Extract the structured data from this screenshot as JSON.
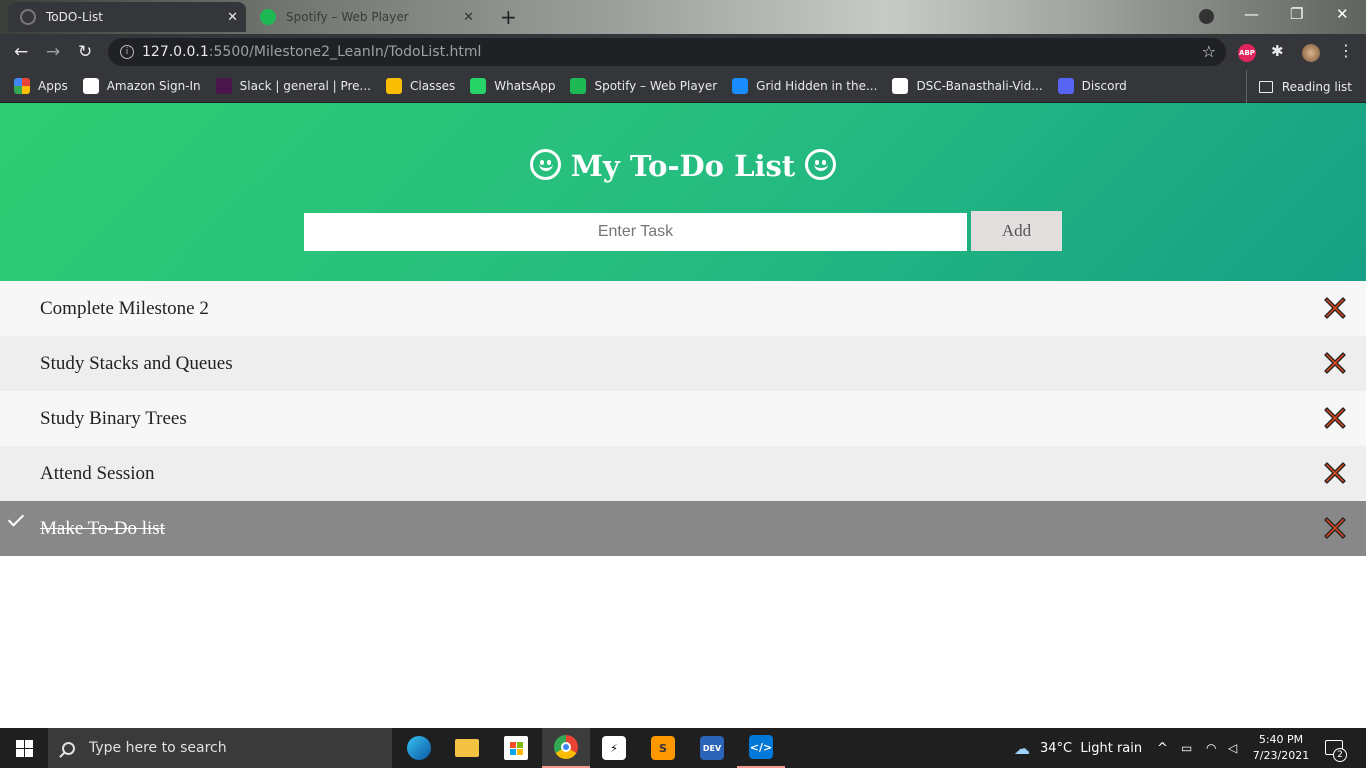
{
  "browser": {
    "tabs": [
      {
        "title": "ToDO-List",
        "active": true
      },
      {
        "title": "Spotify – Web Player",
        "active": false
      }
    ],
    "url_host": "127.0.0.1",
    "url_path": ":5500/Milestone2_LeanIn/TodoList.html",
    "bookmarks": [
      {
        "label": "Apps",
        "icon": "apps-grid-icon",
        "color": "#ea4335"
      },
      {
        "label": "Amazon Sign-In",
        "icon": "amazon-icon",
        "color": "#ffffff"
      },
      {
        "label": "Slack | general | Pre...",
        "icon": "slack-icon",
        "color": "#4a154b"
      },
      {
        "label": "Classes",
        "icon": "classroom-icon",
        "color": "#fbbc04"
      },
      {
        "label": "WhatsApp",
        "icon": "whatsapp-icon",
        "color": "#25d366"
      },
      {
        "label": "Spotify – Web Player",
        "icon": "spotify-icon",
        "color": "#1db954"
      },
      {
        "label": "Grid Hidden in the...",
        "icon": "pb-icon",
        "color": "#1a8cff"
      },
      {
        "label": "DSC-Banasthali-Vid...",
        "icon": "github-icon",
        "color": "#ffffff"
      },
      {
        "label": "Discord",
        "icon": "discord-icon",
        "color": "#5865f2"
      }
    ],
    "reading_list": "Reading list"
  },
  "app": {
    "title": "My To-Do List",
    "input_placeholder": "Enter Task",
    "add_label": "Add",
    "accent_gradient": [
      "#2ecc71",
      "#16a085"
    ],
    "tasks": [
      {
        "text": "Complete Milestone 2",
        "checked": false
      },
      {
        "text": "Study Stacks and Queues",
        "checked": false
      },
      {
        "text": "Study Binary Trees",
        "checked": false
      },
      {
        "text": "Attend Session",
        "checked": false
      },
      {
        "text": "Make To-Do list",
        "checked": true
      }
    ],
    "delete_icon_color": "#e04a1f"
  },
  "taskbar": {
    "search_placeholder": "Type here to search",
    "apps": [
      "edge-icon",
      "file-explorer-icon",
      "store-icon",
      "chrome-icon",
      "zap-app-icon",
      "sublime-icon",
      "devc-icon",
      "vscode-icon"
    ],
    "weather": "34°C  Light rain",
    "time": "5:40 PM",
    "date": "7/23/2021",
    "notification_count": "2"
  }
}
